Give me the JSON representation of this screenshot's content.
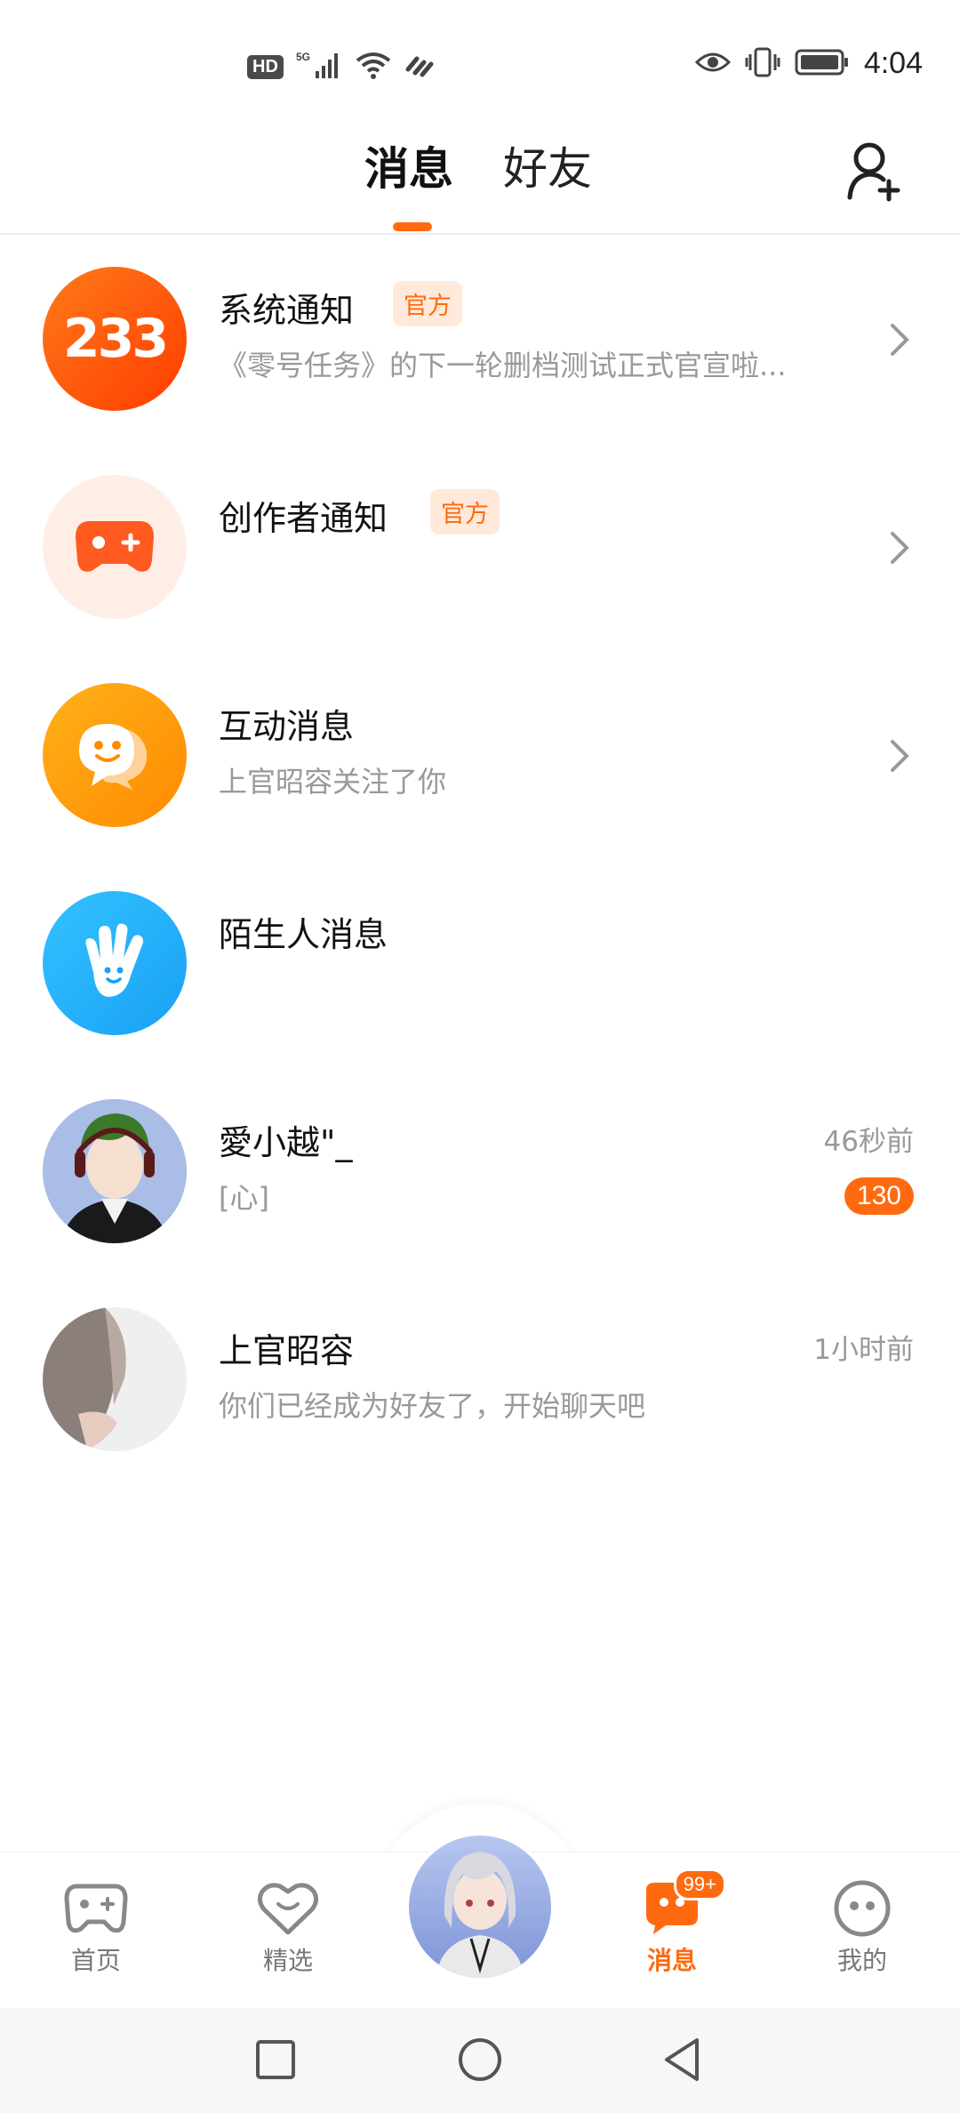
{
  "status_bar": {
    "hd_label": "HD",
    "network_label": "5G",
    "time": "4:04",
    "icons": [
      "hd-icon",
      "signal-icon",
      "wifi-icon",
      "link-icon",
      "eye-icon",
      "vibrate-icon",
      "battery-icon"
    ]
  },
  "header": {
    "tabs": [
      {
        "label": "消息",
        "active": true
      },
      {
        "label": "好友",
        "active": false
      }
    ],
    "add_friend_icon": "add-friend-icon",
    "accent": "#ff6a10"
  },
  "conversations": [
    {
      "title": "系统通知",
      "badge": "官方",
      "subtitle": "《零号任务》的下一轮删档测试正式官宣啦...",
      "avatar_text": "233",
      "has_chevron": true
    },
    {
      "title": "创作者通知",
      "badge": "官方",
      "subtitle": "",
      "avatar_icon": "gamepad-icon",
      "has_chevron": true
    },
    {
      "title": "互动消息",
      "subtitle": "上官昭容关注了你",
      "avatar_icon": "chat-bubble-icon",
      "has_chevron": true
    },
    {
      "title": "陌生人消息",
      "subtitle": "",
      "avatar_icon": "hand-icon",
      "has_chevron": false
    },
    {
      "title": "愛小越\"_",
      "subtitle": "[心]",
      "time": "46秒前",
      "unread": "130"
    },
    {
      "title": "上官昭容",
      "subtitle": "你们已经成为好友了，开始聊天吧",
      "time": "1小时前"
    }
  ],
  "bottom_nav": {
    "items": [
      {
        "label": "首页",
        "icon": "gamepad-icon"
      },
      {
        "label": "精选",
        "icon": "heart-chat-icon"
      },
      {
        "label": "消息",
        "icon": "message-icon",
        "badge": "99+",
        "active": true
      },
      {
        "label": "我的",
        "icon": "face-icon"
      }
    ]
  },
  "system_nav": {
    "icons": [
      "recent-apps-icon",
      "home-icon",
      "back-icon"
    ]
  }
}
